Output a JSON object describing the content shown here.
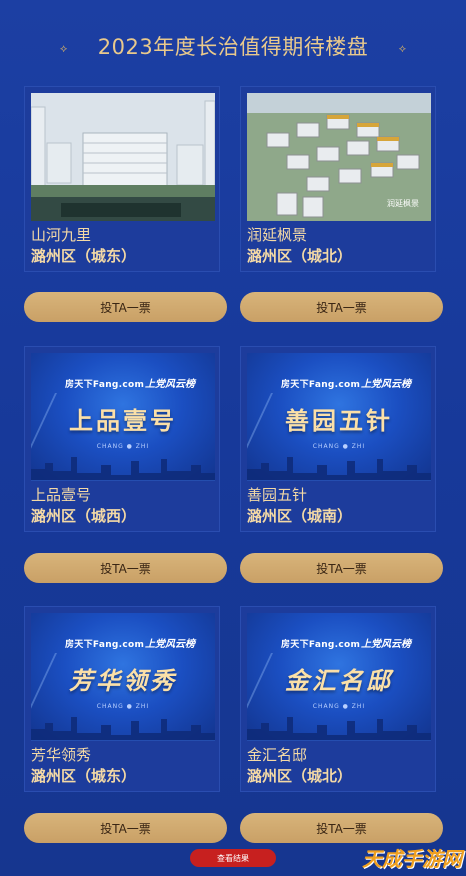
{
  "header": {
    "title": "2023年度长治值得期待楼盘"
  },
  "cards": [
    {
      "name": "山河九里",
      "district": "潞州区（城东）",
      "vote_label": "投TA一票"
    },
    {
      "name": "润延枫景",
      "district": "潞州区（城北）",
      "vote_label": "投TA一票"
    },
    {
      "name": "上品壹号",
      "district": "潞州区（城西）",
      "vote_label": "投TA一票",
      "poster_title": "上品壹号"
    },
    {
      "name": "善园五针",
      "district": "潞州区（城南）",
      "vote_label": "投TA一票",
      "poster_title": "善园五针"
    },
    {
      "name": "芳华领秀",
      "district": "潞州区（城东）",
      "vote_label": "投TA一票",
      "poster_title": "芳华领秀"
    },
    {
      "name": "金汇名邸",
      "district": "潞州区（城北）",
      "vote_label": "投TA一票",
      "poster_title": "金汇名邸"
    }
  ],
  "poster": {
    "brand": "房天下Fang.com",
    "brand2": "上党风云榜",
    "city": "CHANG ● ZHI"
  },
  "photo_caption": "润延枫景",
  "result_button": "查看结果",
  "watermark": "天成手游网",
  "colors": {
    "background": "#1a3a9a",
    "gold": "#e9c98c",
    "button": "#d8b47a",
    "result": "#c7201f"
  }
}
